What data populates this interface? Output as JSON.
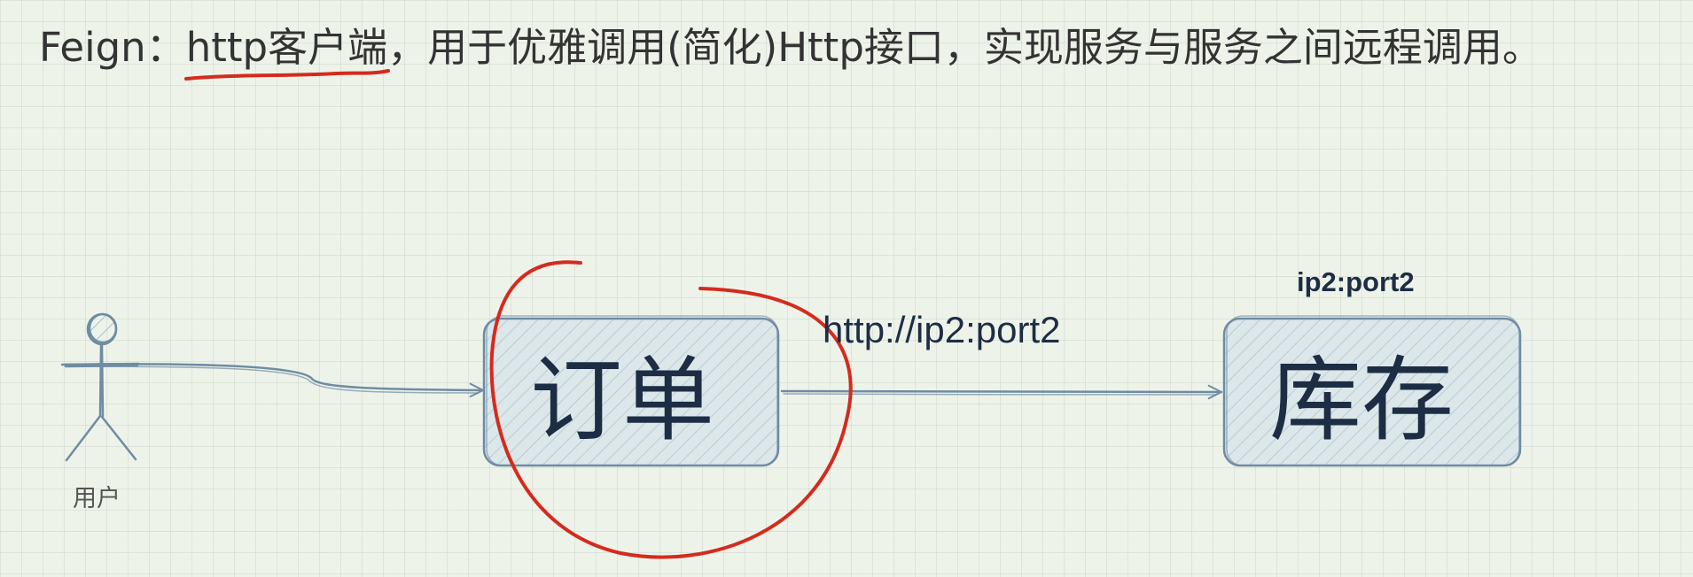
{
  "heading": {
    "prefix": "Feign：",
    "highlight": "http客户端",
    "suffix": "，用于优雅调用(简化)Http接口，实现服务与服务之间远程调用。"
  },
  "actor": {
    "label": "用户"
  },
  "nodes": {
    "order": "订单",
    "stock": "库存"
  },
  "edge": {
    "label": "http://ip2:port2"
  },
  "stock_address": "ip2:port2",
  "colors": {
    "background": "#eef3ea",
    "grid": "#c9d4c6",
    "node_fill": "#dce7ea",
    "node_stroke": "#6f8ca3",
    "hatch": "#a9bfcb",
    "text": "#1d2d44",
    "annotation_red": "#d42b1e"
  },
  "icons": {
    "actor": "stick-figure-user-icon"
  }
}
